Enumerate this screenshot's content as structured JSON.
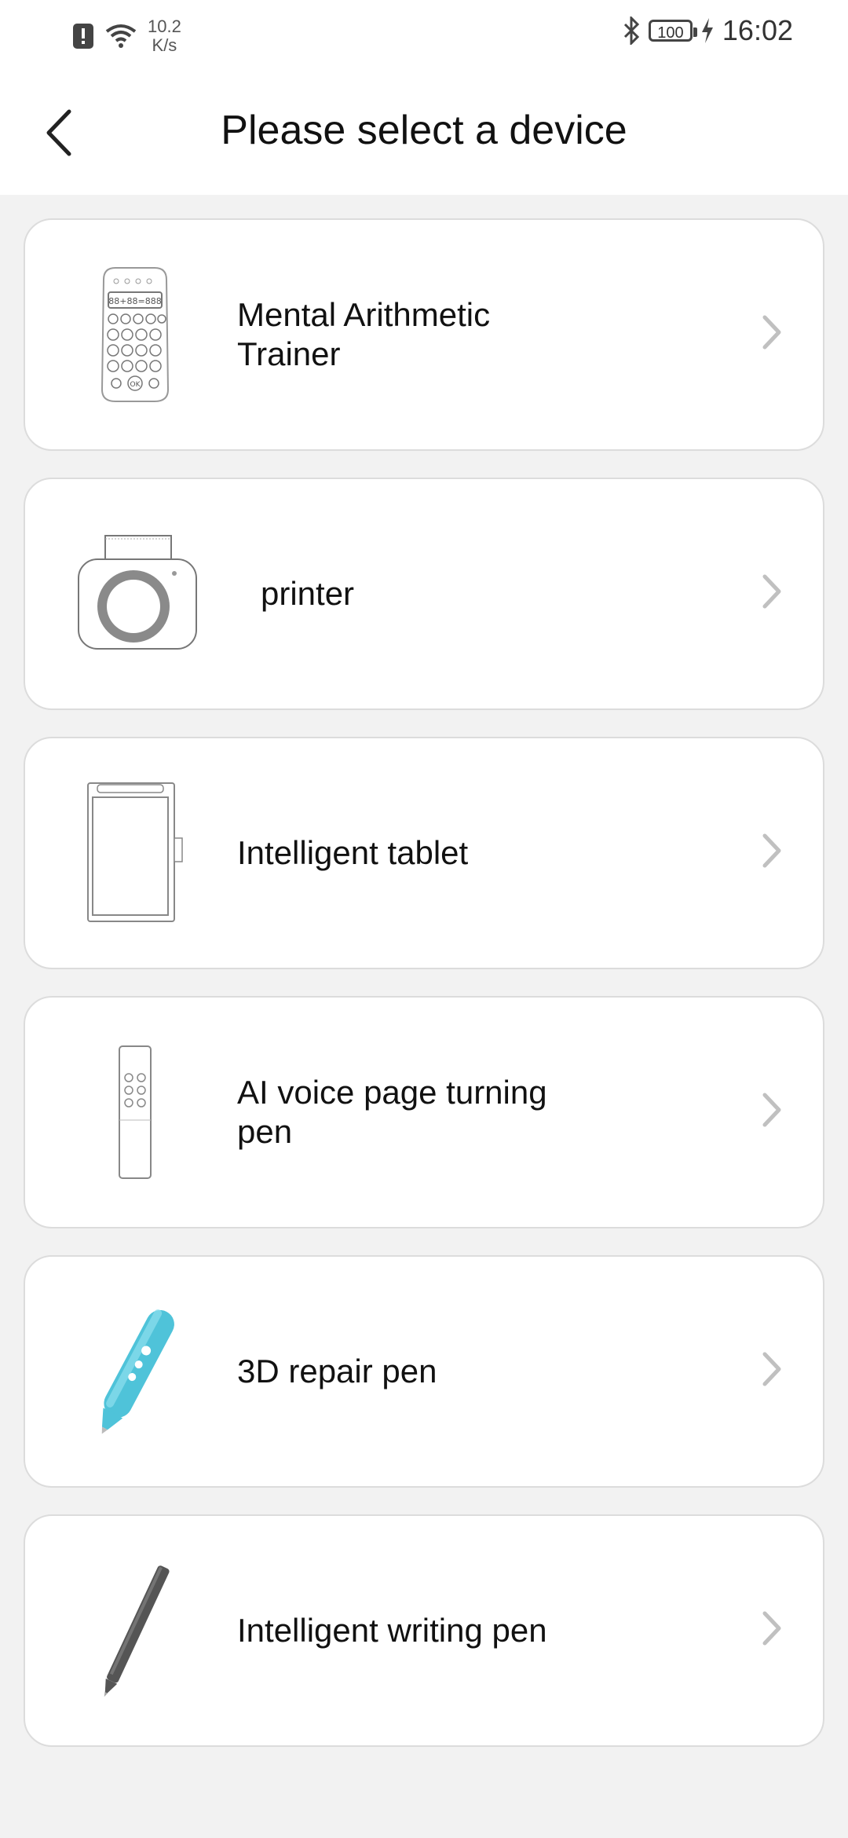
{
  "status_bar": {
    "speed_value": "10.2",
    "speed_unit": "K/s",
    "battery": "100",
    "time": "16:02"
  },
  "header": {
    "title": "Please select a device"
  },
  "devices": [
    {
      "label": "Mental Arithmetic\nTrainer",
      "icon": "calculator-device-icon"
    },
    {
      "label": "printer",
      "icon": "printer-device-icon"
    },
    {
      "label": "Intelligent tablet",
      "icon": "tablet-device-icon"
    },
    {
      "label": "AI voice page turning\npen",
      "icon": "voice-pen-device-icon"
    },
    {
      "label": "3D repair pen",
      "icon": "3d-pen-device-icon"
    },
    {
      "label": "Intelligent writing pen",
      "icon": "writing-pen-device-icon"
    }
  ],
  "colors": {
    "background": "#f2f2f2",
    "card": "#ffffff",
    "chevron": "#c0c0c0",
    "pen_teal": "#4fc3d9"
  }
}
